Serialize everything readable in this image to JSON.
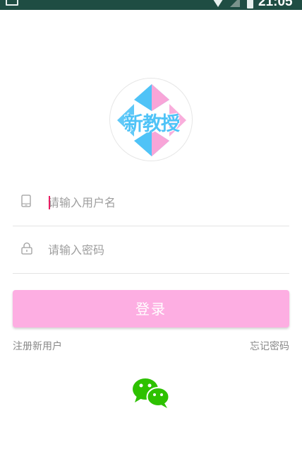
{
  "status_bar": {
    "time": "21:05",
    "icons": [
      "notification-icon",
      "wifi-icon",
      "signal-icon",
      "battery-icon"
    ]
  },
  "logo": {
    "text": "新教授",
    "colors": {
      "blue": "#4fc3f7",
      "pink": "#f8a5d8"
    }
  },
  "form": {
    "username": {
      "placeholder": "请输入用户名",
      "value": "",
      "icon": "phone-icon"
    },
    "password": {
      "placeholder": "请输入密码",
      "value": "",
      "icon": "lock-icon"
    },
    "login_label": "登录"
  },
  "links": {
    "register": "注册新用户",
    "forgot_password": "忘记密码"
  },
  "social": {
    "icon": "wechat-icon"
  },
  "colors": {
    "status_bar": "#1f4d43",
    "accent": "#fdaee2",
    "wechat": "#2dc100",
    "caret": "#e91e63"
  }
}
